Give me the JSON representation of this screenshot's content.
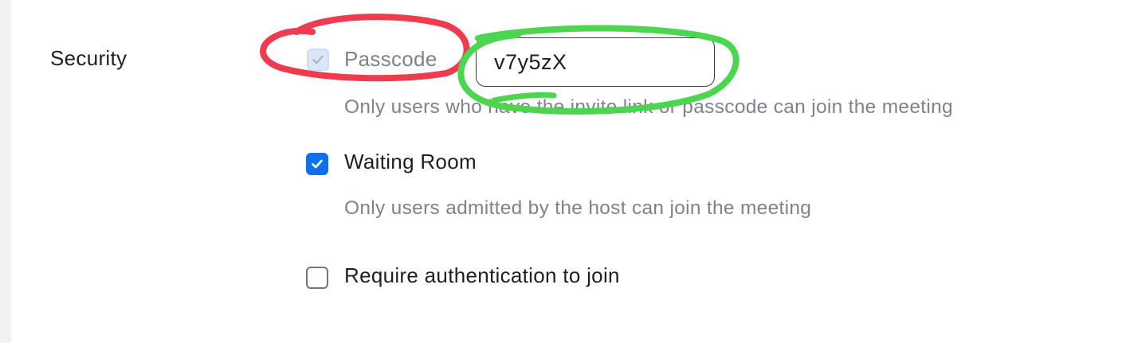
{
  "security": {
    "section_label": "Security",
    "passcode": {
      "label": "Passcode",
      "value": "v7y5zX",
      "description": "Only users who have the invite link or passcode can join the meeting",
      "checked": true,
      "disabled": true
    },
    "waiting_room": {
      "label": "Waiting Room",
      "description": "Only users admitted by the host can join the meeting",
      "checked": true
    },
    "require_auth": {
      "label": "Require authentication to join",
      "checked": false
    }
  },
  "colors": {
    "accent": "#0e71eb",
    "annotation_red": "#ee3b4e",
    "annotation_green": "#4cd54f",
    "muted_text": "#7d838c"
  }
}
